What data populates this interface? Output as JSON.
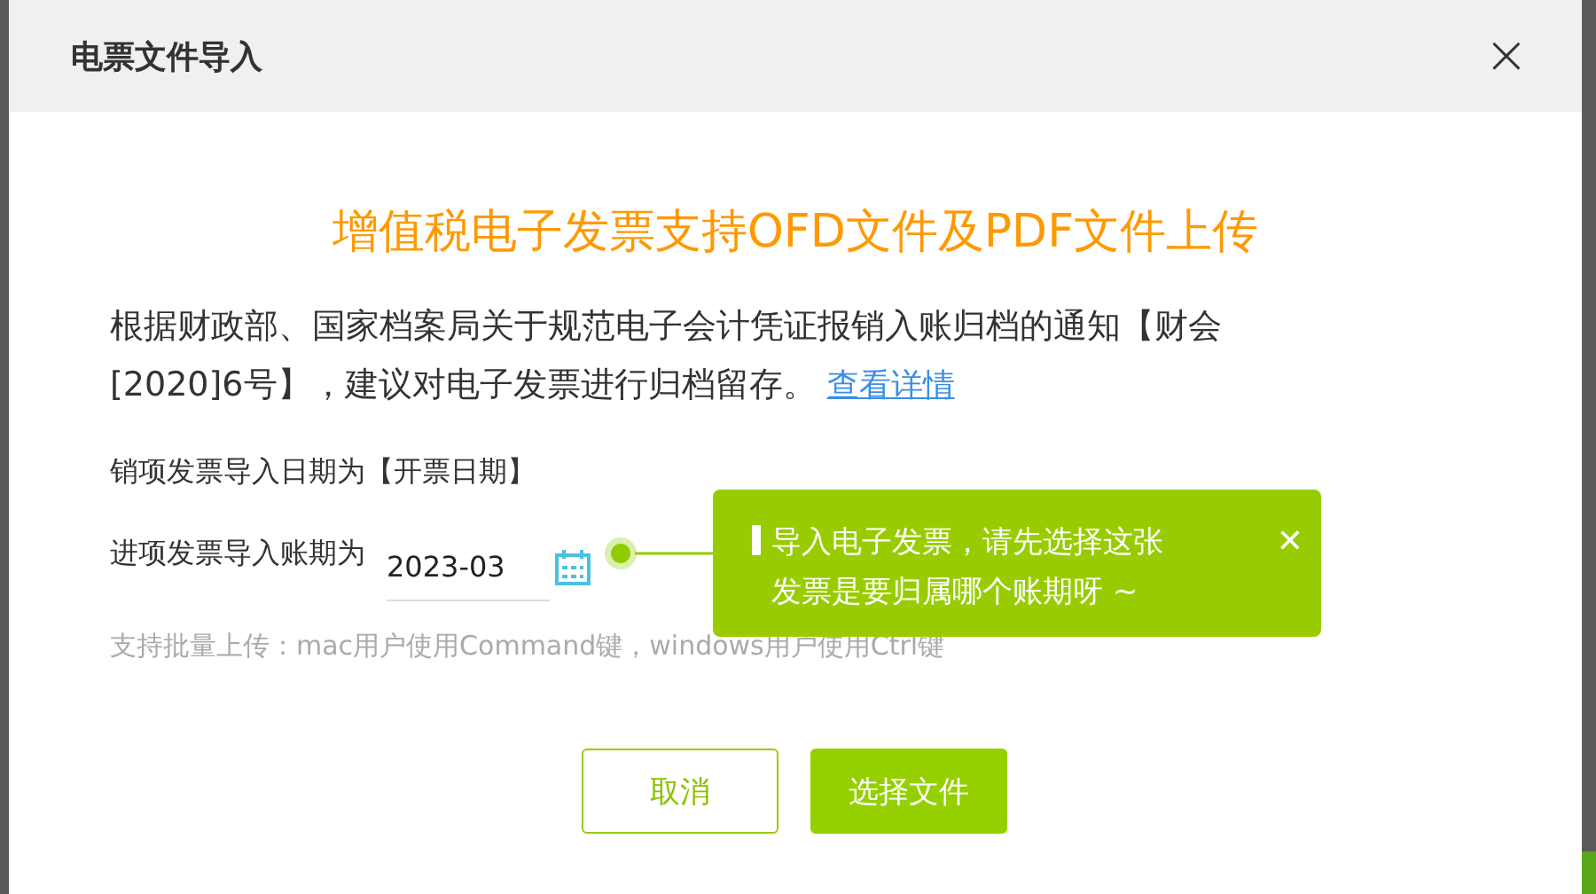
{
  "dialog": {
    "title": "电票文件导入",
    "close": "×"
  },
  "headline": "增值税电子发票支持OFD文件及PDF文件上传",
  "notice": {
    "text": "根据财政部、国家档案局关于规范电子会计凭证报销入账归档的通知【财会[2020]6号】，建议对电子发票进行归档留存。",
    "link": "查看详情"
  },
  "sales_label": "销项发票导入日期为【开票日期】",
  "period_label": "进项发票导入账期为",
  "period_value": "2023-03",
  "tooltip": {
    "text": "导入电子发票，请先选择这张发票是要归属哪个账期呀 ~",
    "close": "✕"
  },
  "hint": "支持批量上传：mac用户使用Command键，windows用户使用Ctrl键",
  "buttons": [
    {
      "label": "取消",
      "kind": "secondary"
    },
    {
      "label": "选择文件",
      "kind": "primary"
    }
  ]
}
